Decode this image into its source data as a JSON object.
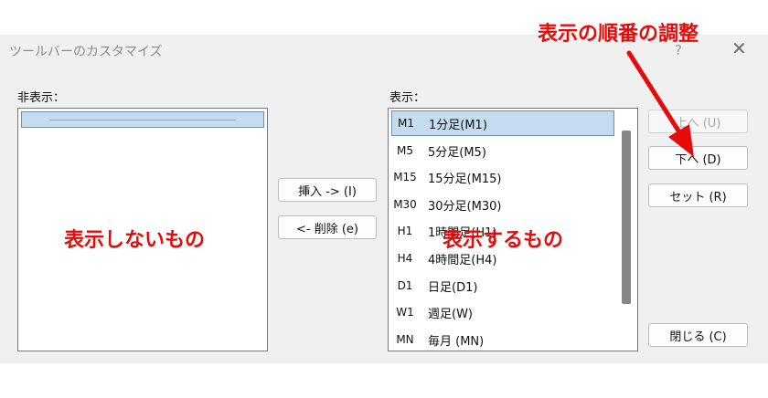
{
  "window": {
    "title": "ツールバーのカスタマイズ",
    "help_symbol": "?",
    "close_symbol": "✕"
  },
  "hidden_panel": {
    "label": "非表示："
  },
  "shown_panel": {
    "label": "表示：",
    "items": [
      {
        "icon": "M1",
        "label": "1分足(M1)",
        "selected": true
      },
      {
        "icon": "M5",
        "label": "5分足(M5)"
      },
      {
        "icon": "M15",
        "label": "15分足(M15)"
      },
      {
        "icon": "M30",
        "label": "30分足(M30)"
      },
      {
        "icon": "H1",
        "label": "1時間足(H1)"
      },
      {
        "icon": "H4",
        "label": "4時間足(H4)"
      },
      {
        "icon": "D1",
        "label": "日足(D1)"
      },
      {
        "icon": "W1",
        "label": "週足(W)"
      },
      {
        "icon": "MN",
        "label": "毎月 (MN)"
      }
    ]
  },
  "buttons": {
    "insert": "挿入 -> (I)",
    "delete": "<- 削除 (e)",
    "up": "上へ (U)",
    "down": "下へ (D)",
    "reset": "セット (R)",
    "close": "閉じる (C)"
  },
  "annotations": {
    "reorder": "表示の順番の調整",
    "not_shown": "表示しないもの",
    "shown": "表示するもの",
    "color": "#e60b0b"
  }
}
